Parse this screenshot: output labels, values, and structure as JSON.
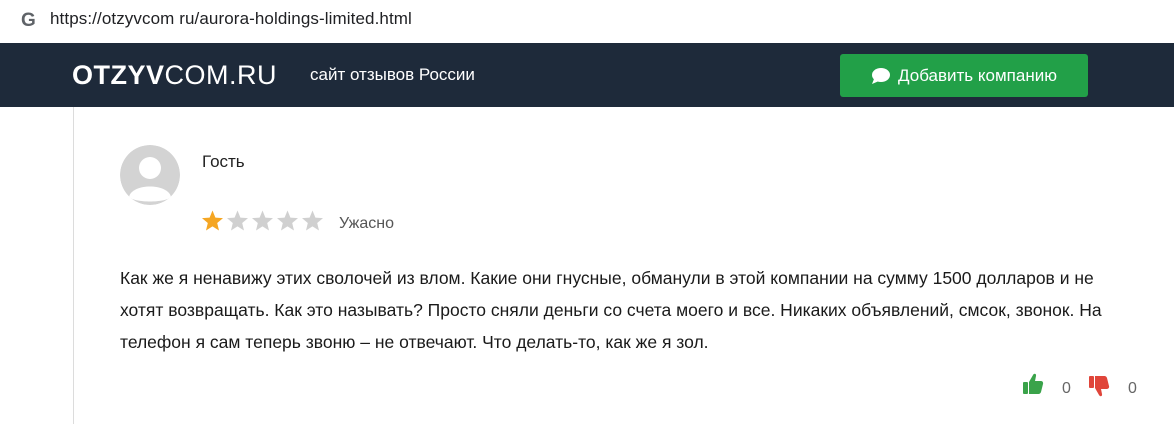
{
  "browser": {
    "url": "https://otzyvcom ru/aurora-holdings-limited.html"
  },
  "header": {
    "logo_bold": "OTZYV",
    "logo_rest": "COM.RU",
    "tagline": "сайт отзывов России",
    "add_button_label": "Добавить компанию"
  },
  "review": {
    "author": "Гость",
    "rating": 1,
    "rating_max": 5,
    "rating_label": "Ужасно",
    "text": "Как же я ненавижу этих сволочей из влом. Какие они гнусные, обманули в этой компании на сумму 1500 долларов и не хотят возвращать. Как это называть? Просто сняли деньги со счета моего и все. Никаких объявлений, смсок, звонок. На телефон я сам теперь звоню – не отвечают. Что делать-то, как же я зол.",
    "likes": "0",
    "dislikes": "0"
  },
  "colors": {
    "header_bg": "#1e2a3a",
    "button_green": "#22a048",
    "star_filled": "#f5a623",
    "star_empty": "#d0d0d0",
    "like_green": "#3aa34a",
    "dislike_red": "#e0453a"
  }
}
